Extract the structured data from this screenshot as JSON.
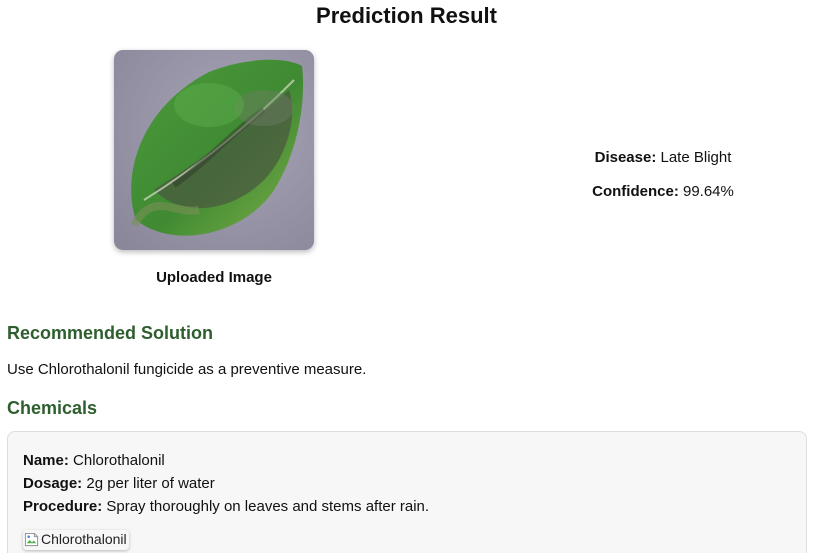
{
  "page": {
    "title": "Prediction Result"
  },
  "upload": {
    "caption": "Uploaded Image"
  },
  "result": {
    "disease_label": "Disease:",
    "disease_value": "Late Blight",
    "confidence_label": "Confidence:",
    "confidence_value": "99.64%"
  },
  "solution": {
    "heading": "Recommended Solution",
    "text": "Use Chlorothalonil fungicide as a preventive measure."
  },
  "chemicals": {
    "heading": "Chemicals",
    "items": [
      {
        "name_label": "Name:",
        "name": "Chlorothalonil",
        "dosage_label": "Dosage:",
        "dosage": "2g per liter of water",
        "procedure_label": "Procedure:",
        "procedure": "Spray thoroughly on leaves and stems after rain.",
        "image_alt": "Chlorothalonil"
      }
    ]
  },
  "colors": {
    "heading_green": "#2e5e2e",
    "card_background": "#f7f7f7"
  }
}
